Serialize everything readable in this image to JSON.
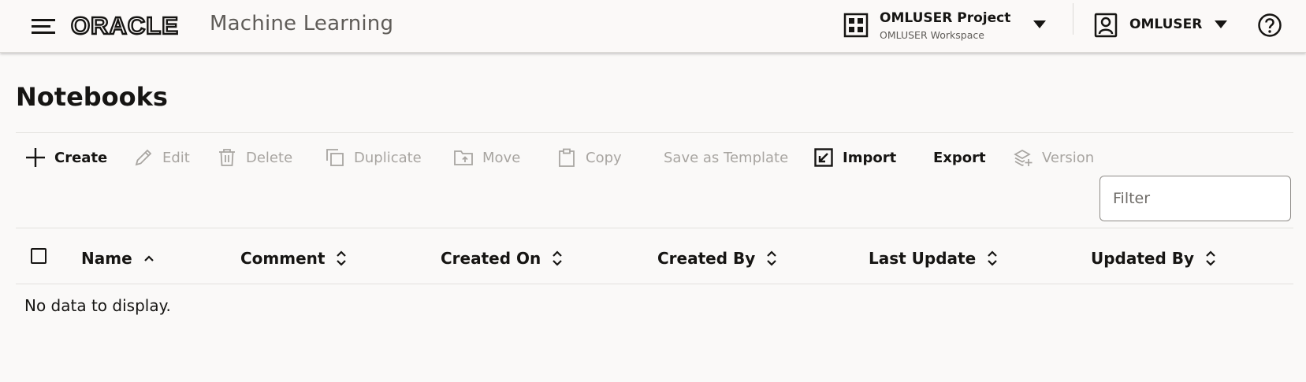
{
  "header": {
    "brand": "ORACLE",
    "app_title": "Machine Learning",
    "project": {
      "name": "OMLUSER Project",
      "workspace": "OMLUSER Workspace"
    },
    "user": {
      "name": "OMLUSER"
    },
    "icons": [
      "hamburger-menu-icon",
      "project-grid-icon",
      "chevron-down-icon",
      "user-icon",
      "help-icon"
    ]
  },
  "page": {
    "title": "Notebooks"
  },
  "toolbar": {
    "create": "Create",
    "edit": "Edit",
    "delete": "Delete",
    "duplicate": "Duplicate",
    "move": "Move",
    "copy": "Copy",
    "save_as_template": "Save as Template",
    "import": "Import",
    "export": "Export",
    "version": "Version"
  },
  "filter": {
    "placeholder": "Filter",
    "value": ""
  },
  "table": {
    "columns": [
      {
        "label": "Name",
        "sort": "ascending"
      },
      {
        "label": "Comment",
        "sort": "none"
      },
      {
        "label": "Created On",
        "sort": "none"
      },
      {
        "label": "Created By",
        "sort": "none"
      },
      {
        "label": "Last Update",
        "sort": "none"
      },
      {
        "label": "Updated By",
        "sort": "none"
      }
    ],
    "rows": [],
    "empty_message": "No data to display."
  },
  "colors": {
    "background": "#faf9f8",
    "text": "#161513",
    "disabled_text": "#a8a5a1",
    "subtitle": "#5f5c58"
  }
}
